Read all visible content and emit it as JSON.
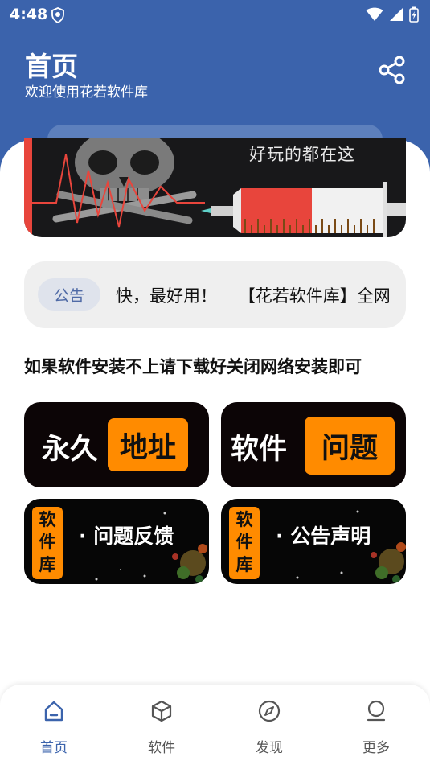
{
  "status_bar": {
    "time": "4:48"
  },
  "header": {
    "title": "首页",
    "subtitle": "欢迎使用花若软件库"
  },
  "banner": {
    "text": "好玩的都在这"
  },
  "notice": {
    "tag": "公告",
    "text": "快，最好用！    【花若软件库】全网"
  },
  "headline": "如果软件安装不上请下载好关闭网络安装即可",
  "tiles": [
    {
      "white": "永久",
      "orange": "地址"
    },
    {
      "white": "软件",
      "orange": "问题"
    },
    {
      "vertical": [
        "软",
        "件",
        "库"
      ],
      "caption": "· 问题反馈"
    },
    {
      "vertical": [
        "软",
        "件",
        "库"
      ],
      "caption": "· 公告声明"
    }
  ],
  "nav": [
    {
      "label": "首页",
      "icon": "home-icon",
      "active": true
    },
    {
      "label": "软件",
      "icon": "cube-icon",
      "active": false
    },
    {
      "label": "发现",
      "icon": "compass-icon",
      "active": false
    },
    {
      "label": "更多",
      "icon": "person-icon",
      "active": false
    }
  ],
  "colors": {
    "header_bg": "#3b63ac",
    "accent_orange": "#ff8b00",
    "nav_active": "#3b63ac"
  }
}
